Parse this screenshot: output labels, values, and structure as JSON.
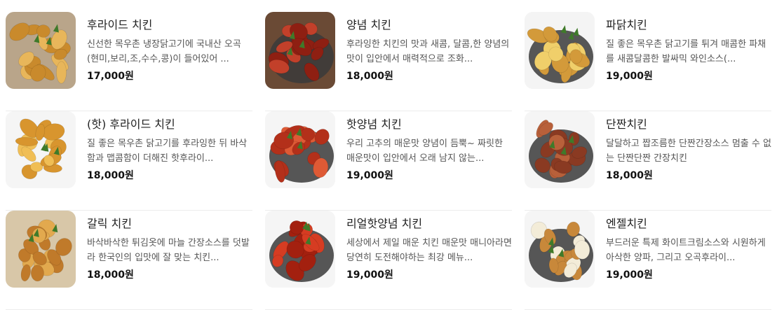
{
  "menu_items": [
    {
      "name": "후라이드 치킨",
      "description": "신선한 목우촌 냉장닭고기에 국내산 오곡(현미,보리,조,수수,콩)이 들어있어 ...",
      "price": "17,000원",
      "image": "fried-chicken-image",
      "colors": {
        "base": "#c98a2c",
        "light": "#e8b65a",
        "bg": "#b9a58a"
      }
    },
    {
      "name": "양념 치킨",
      "description": "후라잉한 치킨의 맛과 새콤, 달콤,한 양념의 맛이 입안에서 매력적으로 조화...",
      "price": "18,000원",
      "image": "seasoned-chicken-image",
      "colors": {
        "base": "#8e1f12",
        "light": "#c2402a",
        "bg": "#6a4a35"
      }
    },
    {
      "name": "파닭치킨",
      "description": "질 좋은 목우촌 닭고기를 튀겨 매콤한 파채를 새콤달콤한 발싸믹 와인소스(...",
      "price": "19,000원",
      "image": "green-onion-chicken-image",
      "colors": {
        "base": "#d39a3a",
        "light": "#f0cf6a",
        "bg": "#f4f4f4"
      }
    },
    {
      "name": "(핫) 후라이드 치킨",
      "description": "질 좋은 목우촌 닭고기를 후라잉한 뒤 바삭함과 맵콤함이 더해진 핫후라이...",
      "price": "18,000원",
      "image": "hot-fried-chicken-image",
      "colors": {
        "base": "#d8952e",
        "light": "#f0be55",
        "bg": "#f5f5f5"
      }
    },
    {
      "name": "핫양념 치킨",
      "description": "우리 고추의 매운맛 양념이 듬뿍~ 짜릿한 매운맛이 입안에서 오래 남지 않는...",
      "price": "19,000원",
      "image": "hot-seasoned-chicken-image",
      "colors": {
        "base": "#b3301a",
        "light": "#de5a35",
        "bg": "#f5f5f5"
      }
    },
    {
      "name": "단짠치킨",
      "description": "달달하고 짭조름한 단짠간장소스 멈출 수 없는 단짠단짠 간장치킨",
      "price": "18,000원",
      "image": "sweet-salty-chicken-image",
      "colors": {
        "base": "#8a3a22",
        "light": "#b8603a",
        "bg": "#f5f5f5"
      }
    },
    {
      "name": "갈릭 치킨",
      "description": "바삭바삭한 튀김옷에 마늘 간장소스를 덧발라 한국인의 입맛에 잘 맞는 치킨...",
      "price": "18,000원",
      "image": "garlic-chicken-image",
      "colors": {
        "base": "#c07a2a",
        "light": "#e2a94e",
        "bg": "#d8c7a8"
      }
    },
    {
      "name": "리얼핫양념 치킨",
      "description": "세상에서 제일 매운 치킨 매운맛 매니아라면 당연히 도전해야하는 최강 메뉴...",
      "price": "19,000원",
      "image": "real-hot-seasoned-chicken-image",
      "colors": {
        "base": "#a3200f",
        "light": "#d63c22",
        "bg": "#f5f5f5"
      }
    },
    {
      "name": "엔젤치킨",
      "description": "부드러운 특제 화이트크림소스와 시원하게 아삭한 양파, 그리고 오곡후라이...",
      "price": "19,000원",
      "image": "angel-chicken-image",
      "colors": {
        "base": "#c8883a",
        "light": "#f3ecd8",
        "bg": "#f5f5f5"
      }
    }
  ]
}
